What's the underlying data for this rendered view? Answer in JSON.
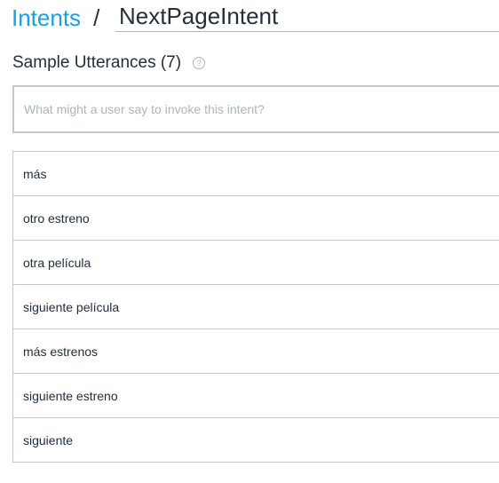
{
  "breadcrumb": {
    "parent_label": "Intents",
    "separator": "/",
    "intent_name": "NextPageIntent"
  },
  "sample_utterances": {
    "title": "Sample Utterances (7)",
    "help_icon": "question-circle-icon",
    "input_placeholder": "What might a user say to invoke this intent?",
    "input_value": "",
    "items": [
      "más",
      "otro estreno",
      "otra película",
      "siguiente película",
      "más estrenos",
      "siguiente estreno",
      "siguiente"
    ]
  },
  "colors": {
    "link": "#1ba1e2",
    "text": "#232f3e",
    "border": "#c3c6cb",
    "placeholder": "#aab7b8"
  }
}
